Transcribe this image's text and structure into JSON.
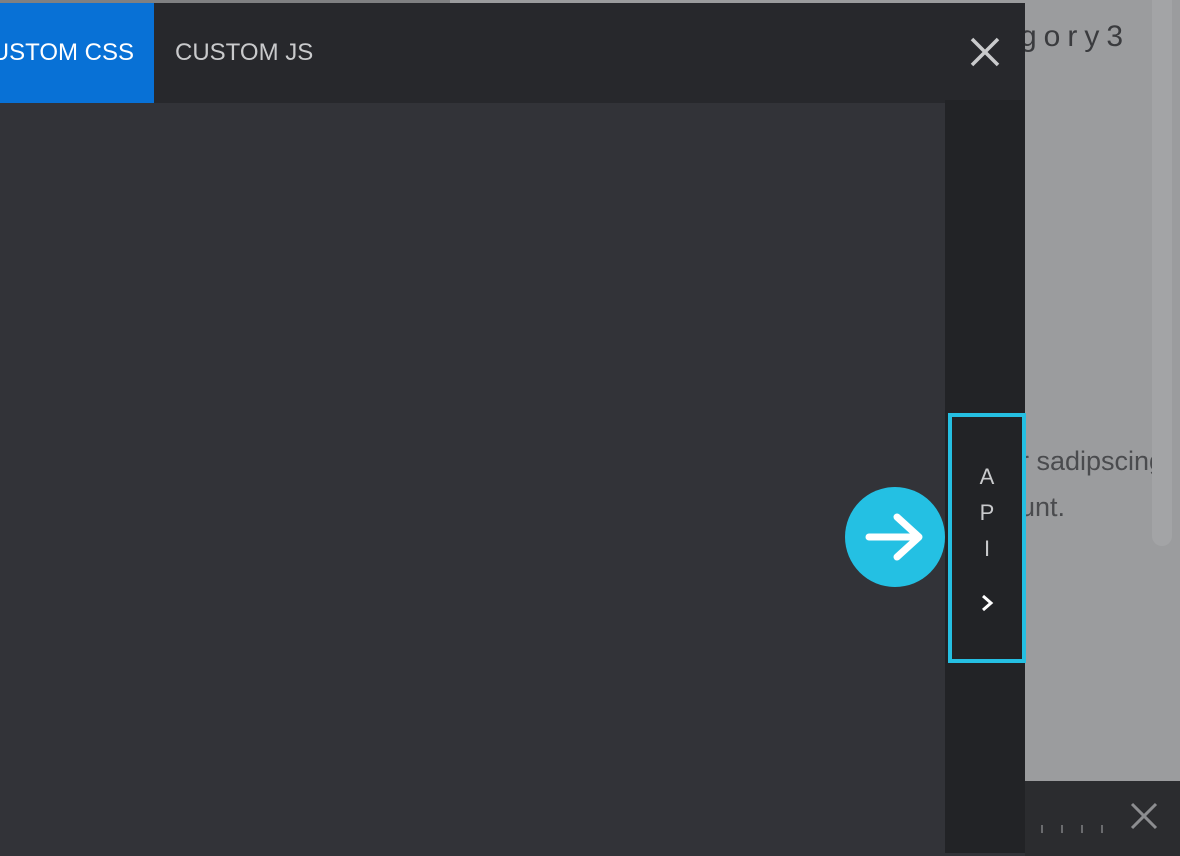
{
  "background_page": {
    "heading_fragment": "gory3",
    "paragraph_lines": [
      "r sadipscing",
      "unt."
    ]
  },
  "editor": {
    "tabs": [
      {
        "label": "USTOM CSS",
        "active": true
      },
      {
        "label": "CUSTOM JS",
        "active": false
      }
    ],
    "api_label": "API",
    "api_letters": [
      "A",
      "P",
      "I"
    ]
  },
  "icons": {
    "close": "close-icon",
    "api_chevron": "chevron-right-icon",
    "hint_arrow": "arrow-right-icon",
    "bottom_close": "close-icon"
  },
  "colors": {
    "accent_active_tab": "#0871d6",
    "highlight_cyan": "#25bfe2",
    "panel_bg": "#323338",
    "tab_bar_bg": "#27282c"
  }
}
